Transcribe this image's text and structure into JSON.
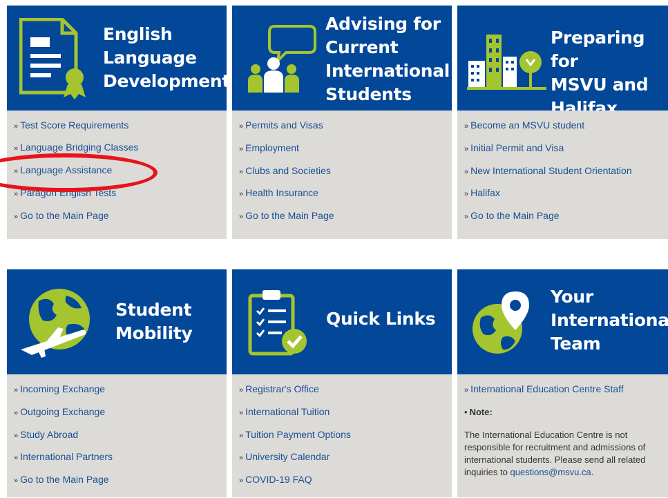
{
  "cards": [
    {
      "title": "English\nLanguage\nDevelopment",
      "icon": "certificate-icon",
      "links": [
        "Test Score Requirements",
        "Language Bridging Classes",
        "Language Assistance",
        "Paragon English Tests",
        "Go to the Main Page"
      ]
    },
    {
      "title": "Advising for\nCurrent\nInternational\nStudents",
      "icon": "advising-group-icon",
      "links": [
        "Permits and Visas",
        "Employment",
        "Clubs and Societies",
        "Health Insurance",
        "Go to the Main Page"
      ]
    },
    {
      "title": "Preparing for\nMSVU and\nHalifax",
      "icon": "city-icon",
      "links": [
        "Become an MSVU student",
        "Initial Permit and Visa",
        "New International Student Orientation",
        "Halifax",
        "Go to the Main Page"
      ]
    },
    {
      "title": "Student\nMobility",
      "icon": "globe-airplane-icon",
      "links": [
        "Incoming Exchange",
        "Outgoing Exchange",
        "Study Abroad",
        "International Partners",
        "Go to the Main Page"
      ]
    },
    {
      "title": "Quick Links",
      "icon": "clipboard-checklist-icon",
      "links": [
        "Registrar's Office",
        "International Tuition",
        "Tuition Payment Options",
        "University Calendar",
        "COVID-19 FAQ"
      ]
    },
    {
      "title": "Your\nInternational\nTeam",
      "icon": "globe-location-icon",
      "links": [
        "International Education Centre Staff"
      ],
      "note_label": "Note:",
      "note_text": "The International Education Centre is not responsible for recruitment and admissions of international students. Please send all related inquiries to ",
      "note_email": "questions@msvu.ca",
      "note_end": "."
    }
  ],
  "link_prefix": "»",
  "colors": {
    "header": "#024798",
    "accent": "#a4c52f",
    "body": "#dcdbd7",
    "link": "#1b4f94",
    "annotation": "#e8141b"
  }
}
